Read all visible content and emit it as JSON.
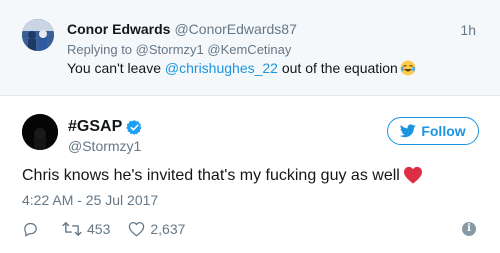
{
  "reply_tweet": {
    "name": "Conor Edwards",
    "handle": "@ConorEdwards87",
    "time": "1h",
    "replying_prefix": "Replying to",
    "replying_to": "@Stormzy1 @KemCetinay",
    "text_before": "You can't leave ",
    "mention": "@chrishughes_22",
    "text_after": " out of the equation",
    "emoji": "face-with-tears-of-joy-icon"
  },
  "main_tweet": {
    "name": "#GSAP",
    "handle": "@Stormzy1",
    "verified_icon": "verified-badge-icon",
    "follow_label": "Follow",
    "text": "Chris knows he's invited that's my fucking guy as well",
    "emoji": "red-heart-icon",
    "timestamp": "4:22 AM - 25 Jul 2017"
  },
  "actions": {
    "retweets": "453",
    "likes": "2,637"
  },
  "colors": {
    "accent": "#1b95e0",
    "secondary_text": "#657786",
    "reply_background": "#f5f8fa",
    "heart": "#dd2e44"
  }
}
